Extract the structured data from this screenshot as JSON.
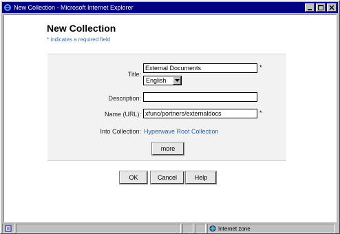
{
  "window": {
    "title": "New Collection - Microsoft Internet Explorer"
  },
  "page": {
    "title": "New Collection",
    "required_note": "* indicates a required field"
  },
  "form": {
    "title_label": "Title:",
    "title_value": "External Documents",
    "language_value": "English",
    "description_label": "Description:",
    "description_value": "",
    "name_label": "Name (URL):",
    "name_value": "xfunc/portners/externaldocs",
    "into_label": "Into Collection:",
    "into_value": "Hyperwave Root Collection",
    "more_label": "more",
    "required_mark": "*"
  },
  "buttons": {
    "ok": "OK",
    "cancel": "Cancel",
    "help": "Help"
  },
  "status": {
    "zone": "Internet zone"
  },
  "colors": {
    "titlebar": "#000080",
    "link": "#2a63a8",
    "note": "#3a6fb3"
  }
}
